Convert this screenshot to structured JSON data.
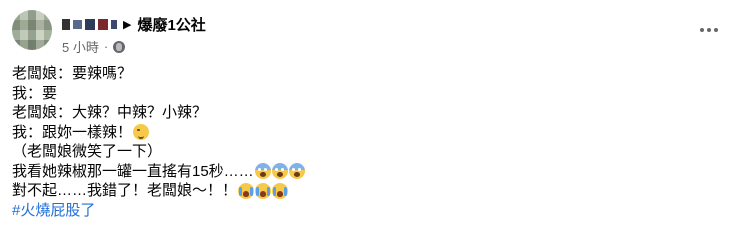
{
  "post": {
    "page_name": "爆廢1公社",
    "time": "5 小時",
    "separator": "·",
    "lines": [
      "老闆娘：要辣嗎？",
      "我：要",
      "老闆娘：大辣？中辣？小辣？",
      "我：跟妳一樣辣！",
      "（老闆娘微笑了一下）",
      "我看她辣椒那一罐一直搖有15秒……",
      "對不起……我錯了！老闆娘～！！"
    ],
    "hashtag": "#火燒屁股了",
    "emojis": {
      "line4": [
        "wink-emoji"
      ],
      "line6": [
        "scream-emoji",
        "scream-emoji",
        "scream-emoji"
      ],
      "line7": [
        "cry-emoji",
        "cry-emoji",
        "cry-emoji"
      ]
    },
    "colors": {
      "text": "#050505",
      "meta": "#65676b",
      "hashtag": "#216fdb"
    }
  }
}
